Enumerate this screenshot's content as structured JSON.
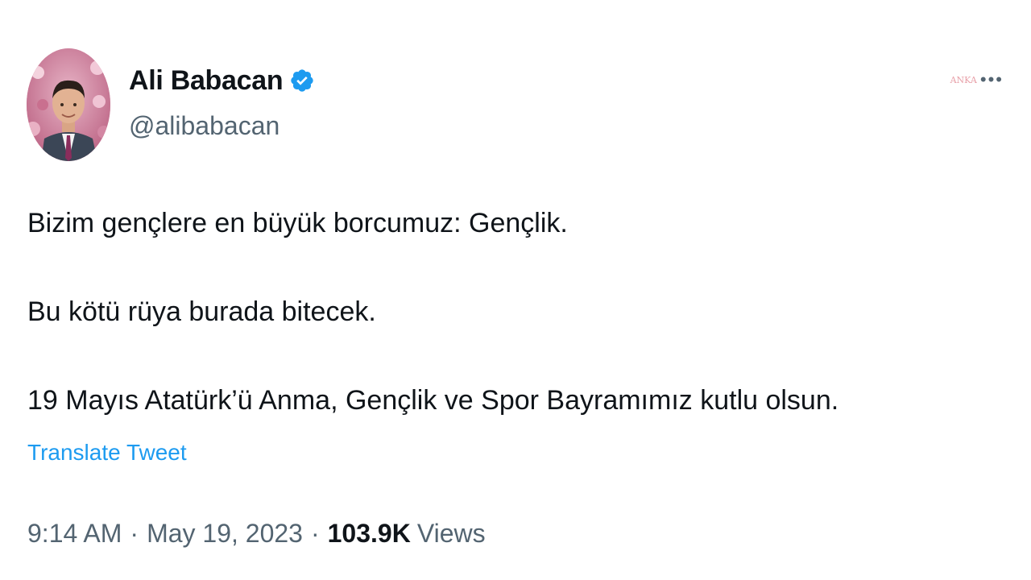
{
  "author": {
    "display_name": "Ali Babacan",
    "handle": "@alibabacan",
    "verified_icon": "verified-badge-icon",
    "avatar_icon": "profile-photo"
  },
  "header": {
    "more_label": "ANKA",
    "more_icon": "•••"
  },
  "tweet": {
    "paragraphs": [
      "Bizim gençlere en büyük borcumuz: Gençlik.",
      "Bu kötü rüya burada bitecek.",
      "19 Mayıs Atatürk’ü Anma, Gençlik ve Spor Bayramımız kutlu olsun."
    ],
    "translate_label": "Translate Tweet"
  },
  "meta": {
    "time": "9:14 AM",
    "separator": "·",
    "date": "May 19, 2023",
    "views_count": "103.9K",
    "views_label": "Views"
  },
  "colors": {
    "link": "#1d9bf0",
    "secondary": "#536471",
    "primary": "#0f1419",
    "verified": "#1d9bf0"
  }
}
